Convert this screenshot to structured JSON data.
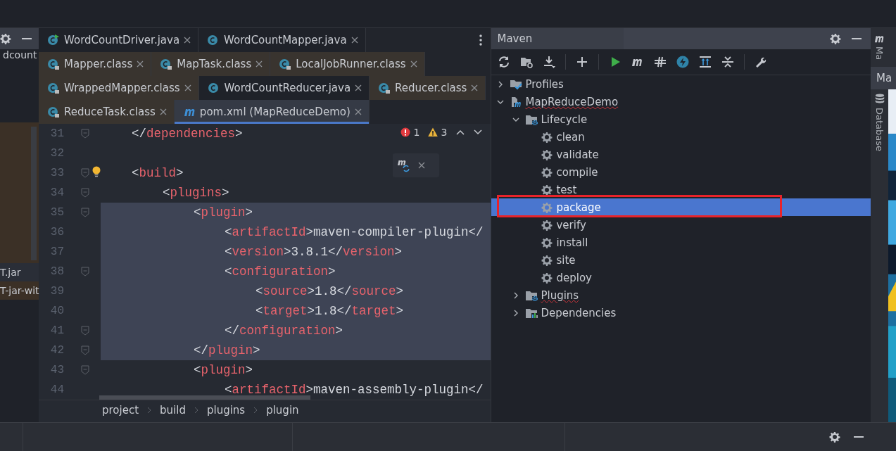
{
  "project_panel": {
    "label": "dcount",
    "files": [
      {
        "label": "T.jar",
        "highlighted": false
      },
      {
        "label": "T-jar-wit",
        "highlighted": true
      }
    ]
  },
  "editor": {
    "tab_rows": [
      [
        {
          "label": "WordCountDriver.java",
          "kind": "runnable",
          "selected": false
        },
        {
          "label": "WordCountMapper.java",
          "kind": "java",
          "selected": false
        }
      ],
      [
        {
          "label": "Mapper.class",
          "kind": "class",
          "selected": false
        },
        {
          "label": "MapTask.class",
          "kind": "class",
          "selected": false
        },
        {
          "label": "LocalJobRunner.class",
          "kind": "class",
          "selected": false
        }
      ],
      [
        {
          "label": "WrappedMapper.class",
          "kind": "class",
          "selected": false
        },
        {
          "label": "WordCountReducer.java",
          "kind": "java",
          "selected": false
        },
        {
          "label": "Reducer.class",
          "kind": "class",
          "selected": false
        }
      ],
      [
        {
          "label": "ReduceTask.class",
          "kind": "class",
          "selected": false
        },
        {
          "label": "pom.xml (MapReduceDemo)",
          "kind": "maven",
          "selected": true
        }
      ]
    ],
    "inspections": {
      "errors": "1",
      "warnings": "3"
    },
    "lines": [
      {
        "number": "31",
        "code": "    </dependencies>",
        "fold": true,
        "selected": false
      },
      {
        "number": "32",
        "fold": false,
        "selected": false
      },
      {
        "number": "33",
        "code": "    <build>",
        "fold": true,
        "selected": false,
        "bulb": true
      },
      {
        "number": "34",
        "code": "        <plugins>",
        "fold": true,
        "selected": false
      },
      {
        "number": "35",
        "code": "            <plugin>",
        "fold": true,
        "selected": true
      },
      {
        "number": "36",
        "code": "                <artifactId>maven-compiler-plugin</",
        "fold": false,
        "selected": true
      },
      {
        "number": "37",
        "code": "                <version>3.8.1</version>",
        "fold": false,
        "selected": true
      },
      {
        "number": "38",
        "code": "                <configuration>",
        "fold": true,
        "selected": true
      },
      {
        "number": "39",
        "code": "                    <source>1.8</source>",
        "fold": false,
        "selected": true
      },
      {
        "number": "40",
        "code": "                    <target>1.8</target>",
        "fold": false,
        "selected": true
      },
      {
        "number": "41",
        "code": "                </configuration>",
        "fold": true,
        "selected": true
      },
      {
        "number": "42",
        "code": "            </plugin>",
        "fold": true,
        "selected": true
      },
      {
        "number": "43",
        "code": "            <plugin>",
        "fold": true,
        "selected": false
      },
      {
        "number": "44",
        "code": "                <artifactId>maven-assembly-plugin</",
        "fold": false,
        "selected": false
      }
    ],
    "breadcrumbs": [
      "project",
      "build",
      "plugins",
      "plugin"
    ]
  },
  "maven": {
    "title": "Maven",
    "tree": [
      {
        "label": "Profiles",
        "kind": "profiles",
        "expanded": false
      },
      {
        "label": "MapReduceDemo",
        "kind": "project",
        "expanded": true,
        "spell_warning": true,
        "children": [
          {
            "label": "Lifecycle",
            "kind": "folder",
            "expanded": true,
            "children": [
              {
                "label": "clean",
                "kind": "goal",
                "selected": false
              },
              {
                "label": "validate",
                "kind": "goal",
                "selected": false
              },
              {
                "label": "compile",
                "kind": "goal",
                "selected": false
              },
              {
                "label": "test",
                "kind": "goal",
                "selected": false
              },
              {
                "label": "package",
                "kind": "goal",
                "selected": true,
                "outlined": true
              },
              {
                "label": "verify",
                "kind": "goal",
                "selected": false
              },
              {
                "label": "install",
                "kind": "goal",
                "selected": false
              },
              {
                "label": "site",
                "kind": "goal",
                "selected": false
              },
              {
                "label": "deploy",
                "kind": "goal",
                "selected": false
              }
            ]
          },
          {
            "label": "Plugins",
            "kind": "folder",
            "expanded": false,
            "spell_warning": true
          },
          {
            "label": "Dependencies",
            "kind": "dependencies",
            "expanded": false
          }
        ]
      }
    ]
  },
  "side_strip": {
    "tabs": [
      {
        "label": "Ma",
        "kind": "vertical",
        "selected": false
      },
      {
        "label": "Ma",
        "kind": "horizontal",
        "selected": true
      },
      {
        "label": "Database",
        "kind": "vertical",
        "selected": false
      }
    ]
  }
}
